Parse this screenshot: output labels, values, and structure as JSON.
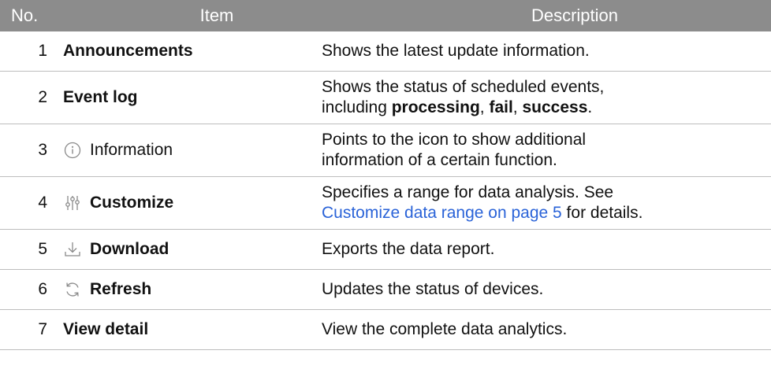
{
  "header": {
    "no": "No.",
    "item": "Item",
    "description": "Description"
  },
  "rows": [
    {
      "no": "1",
      "item": "Announcements",
      "desc": "Shows the latest update information."
    },
    {
      "no": "2",
      "item": "Event log",
      "desc_line1": "Shows the status of scheduled events,",
      "desc_line2_prefix": "including ",
      "desc_processing": "processing",
      "desc_sep1": ", ",
      "desc_fail": "fail",
      "desc_sep2": ", ",
      "desc_success": "success",
      "desc_end": "."
    },
    {
      "no": "3",
      "item": "Information",
      "icon": "info-icon",
      "desc_line1": "Points to the icon to show additional",
      "desc_line2": "information of a certain function."
    },
    {
      "no": "4",
      "item": "Customize",
      "icon": "sliders-icon",
      "desc_line1": "Specifies a range for data analysis. See",
      "desc_link": "Customize data range on page 5",
      "desc_tail": " for details."
    },
    {
      "no": "5",
      "item": "Download",
      "icon": "download-icon",
      "desc": "Exports the data report."
    },
    {
      "no": "6",
      "item": "Refresh",
      "icon": "refresh-icon",
      "desc": "Updates the status of devices."
    },
    {
      "no": "7",
      "item": "View detail",
      "desc": "View the complete data analytics."
    }
  ],
  "colors": {
    "header_bg": "#8c8c8c",
    "link": "#2a63d8",
    "divider": "#bdbdbd",
    "icon_gray": "#8a8a8a"
  }
}
